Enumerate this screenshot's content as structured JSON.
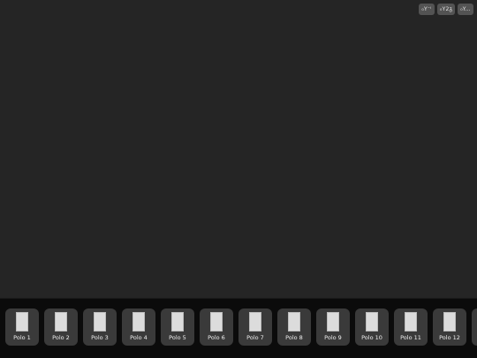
{
  "toolbar": {
    "buttons": [
      {
        "label": "₀Y⁻ⁱ"
      },
      {
        "label": "₀Y2ᵹ"
      },
      {
        "label": "₀Y..."
      }
    ]
  },
  "thumbnails": [
    {
      "label": "Polo 1"
    },
    {
      "label": "Polo 2"
    },
    {
      "label": "Polo 3"
    },
    {
      "label": "Polo 4"
    },
    {
      "label": "Polo 5"
    },
    {
      "label": "Polo 6"
    },
    {
      "label": "Polo 7"
    },
    {
      "label": "Polo 8"
    },
    {
      "label": "Polo 9"
    },
    {
      "label": "Polo 10"
    },
    {
      "label": "Polo 11"
    },
    {
      "label": "Polo 12"
    }
  ]
}
